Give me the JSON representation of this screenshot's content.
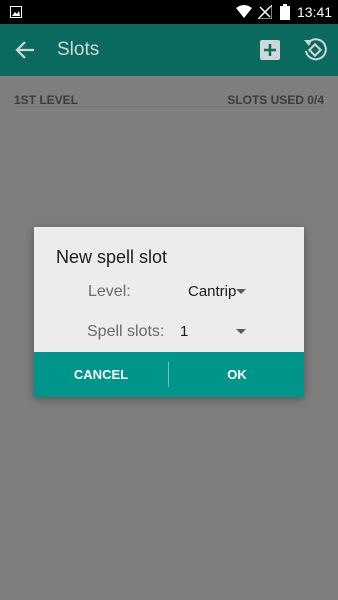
{
  "status_bar": {
    "time": "13:41"
  },
  "toolbar": {
    "title": "Slots",
    "icons": [
      "back-arrow-icon",
      "add-box-icon",
      "rotate-icon"
    ]
  },
  "list": {
    "level_header": "1ST LEVEL",
    "slots_used": "SLOTS USED 0/4"
  },
  "dialog": {
    "title": "New spell slot",
    "level_label": "Level:",
    "level_value": "Cantrip",
    "slots_label": "Spell slots:",
    "slots_value": "1",
    "cancel_label": "CANCEL",
    "ok_label": "OK"
  },
  "colors": {
    "toolbar": "#0a6a5f",
    "dialog_buttons": "#00958a",
    "scrim": "#7e7e7e"
  }
}
